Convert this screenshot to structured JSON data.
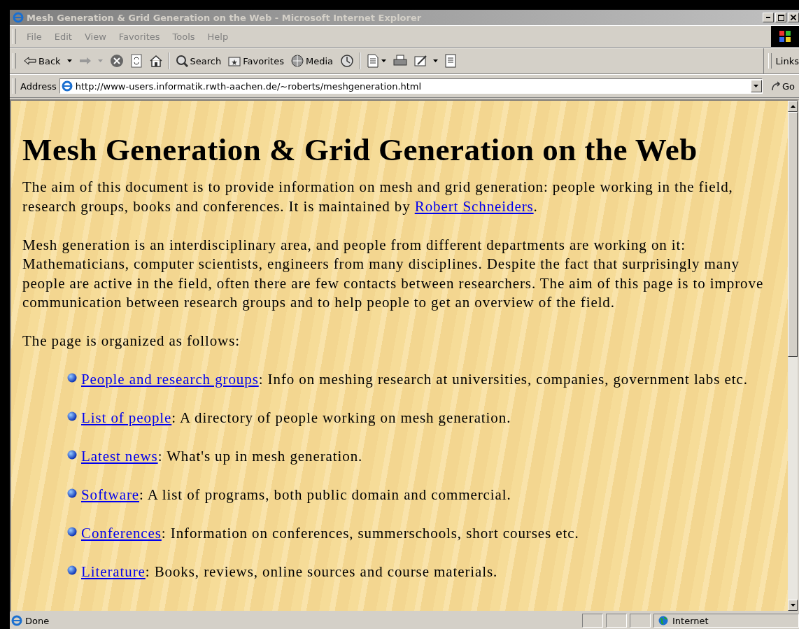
{
  "window": {
    "title": "Mesh Generation & Grid Generation on the Web - Microsoft Internet Explorer"
  },
  "menu": [
    "File",
    "Edit",
    "View",
    "Favorites",
    "Tools",
    "Help"
  ],
  "toolbar": {
    "back": "Back",
    "search": "Search",
    "favorites": "Favorites",
    "media": "Media",
    "links": "Links"
  },
  "address": {
    "label": "Address",
    "value": "http://www-users.informatik.rwth-aachen.de/~roberts/meshgeneration.html",
    "go": "Go"
  },
  "page": {
    "heading": "Mesh Generation & Grid Generation on the Web",
    "intro": {
      "before": "The aim of this document is to provide information on mesh and grid generation: people working in the field, research groups, books and conferences. It is maintained by ",
      "link": "Robert Schneiders",
      "after": "."
    },
    "paragraph": "Mesh generation is an interdisciplinary area, and people from different departments are working on it: Mathematicians, computer scientists, engineers from many disciplines. Despite the fact that surprisingly many people are active in the field, often there are few contacts between researchers. The aim of this page is to improve communication between research groups and to help people to get an overview of the field.",
    "list_intro": "The page is organized as follows:",
    "items": [
      {
        "link": "People and research groups",
        "text": ": Info on meshing research at universities, companies, government labs etc."
      },
      {
        "link": "List of people",
        "text": ": A directory of people working on mesh generation."
      },
      {
        "link": "Latest news",
        "text": ": What's up in mesh generation."
      },
      {
        "link": "Software",
        "text": ": A list of programs, both public domain and commercial."
      },
      {
        "link": "Conferences",
        "text": ": Information on conferences, summerschools, short courses etc."
      },
      {
        "link": "Literature",
        "text": ": Books, reviews, online sources and course materials."
      }
    ]
  },
  "status_bar": {
    "text": "Done",
    "zone": "Internet"
  }
}
